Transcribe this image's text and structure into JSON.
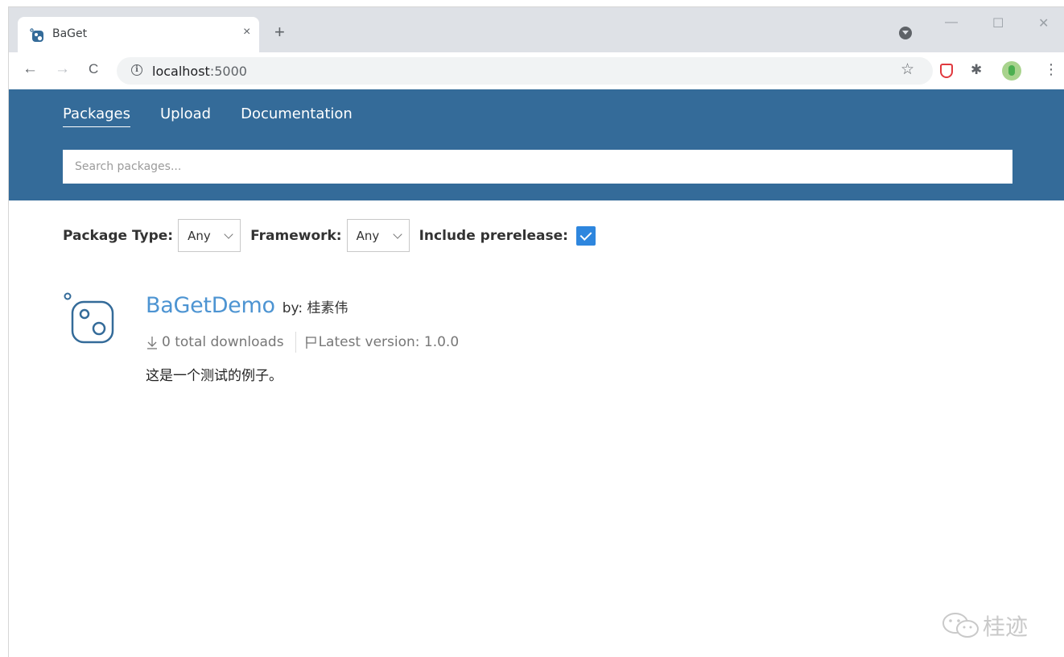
{
  "browser": {
    "tab_title": "BaGet",
    "close_glyph": "×",
    "new_tab_glyph": "+",
    "url_host": "localhost",
    "url_port": ":5000",
    "info_glyph": "i",
    "back_glyph": "←",
    "forward_glyph": "→",
    "reload_glyph": "C",
    "star_glyph": "☆",
    "puzzle_glyph": "✱",
    "menu_glyph": "⋮",
    "minimize_glyph": "—",
    "maximize_glyph": "☐",
    "window_close_glyph": "✕"
  },
  "nav": {
    "items": [
      {
        "label": "Packages",
        "active": true
      },
      {
        "label": "Upload",
        "active": false
      },
      {
        "label": "Documentation",
        "active": false
      }
    ]
  },
  "search": {
    "placeholder": "Search packages...",
    "value": ""
  },
  "filters": {
    "package_type_label": "Package Type:",
    "package_type_value": "Any",
    "framework_label": "Framework:",
    "framework_value": "Any",
    "prerelease_label": "Include prerelease:",
    "prerelease_checked": true
  },
  "results": [
    {
      "name": "BaGetDemo",
      "by": "by: 桂素伟",
      "downloads": "0 total downloads",
      "latest_version": "Latest version: 1.0.0",
      "description": "这是一个测试的例子。"
    }
  ],
  "watermark": {
    "text": "桂迹"
  },
  "colors": {
    "header_bg": "#346b99",
    "link": "#4d94d2",
    "checkbox": "#2e86de"
  },
  "icons": {
    "favicon": "baget-logo-icon",
    "download": "arrow-down-icon",
    "flag": "flag-icon",
    "wechat": "wechat-icon"
  }
}
